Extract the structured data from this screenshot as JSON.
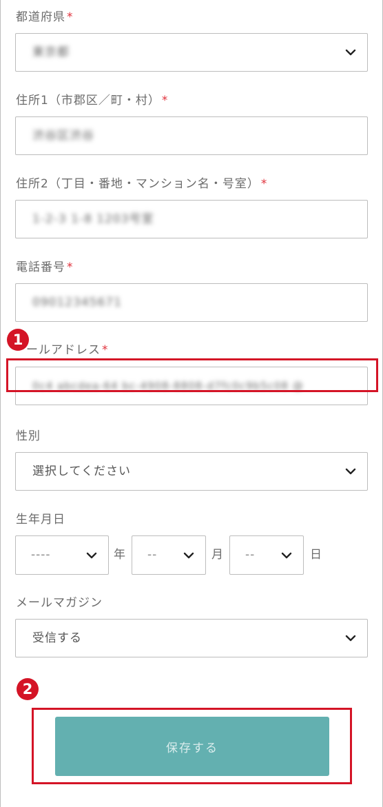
{
  "form": {
    "prefecture": {
      "label": "都道府県",
      "required_mark": "*",
      "value": "東京都"
    },
    "address1": {
      "label": "住所1（市郡区／町・村）",
      "required_mark": "*",
      "value": "渋谷区渋谷"
    },
    "address2": {
      "label": "住所2（丁目・番地・マンション名・号室）",
      "required_mark": "*",
      "value": "1-2-3 1-8 1203号室"
    },
    "phone": {
      "label": "電話番号",
      "required_mark": "*",
      "value": "09012345671"
    },
    "email": {
      "label": "ールアドレス",
      "required_mark": "*",
      "value": "0c4 abcdea-64 bc-4908-8808-d7fc0c9b5c08 @"
    },
    "gender": {
      "label": "性別",
      "value": "選択してください"
    },
    "birthdate": {
      "label": "生年月日",
      "year": {
        "value": "----",
        "unit": "年"
      },
      "month": {
        "value": "--",
        "unit": "月"
      },
      "day": {
        "value": "--",
        "unit": "日"
      }
    },
    "newsletter": {
      "label": "メールマガジン",
      "value": "受信する"
    },
    "save_label": "保存する"
  },
  "annotations": {
    "badge1": "1",
    "badge2": "2",
    "color": "#d41426"
  },
  "icons": {
    "select_arrow": "chevron-down-icon"
  },
  "colors": {
    "button": "#63b0b0",
    "required": "#e0323c"
  }
}
